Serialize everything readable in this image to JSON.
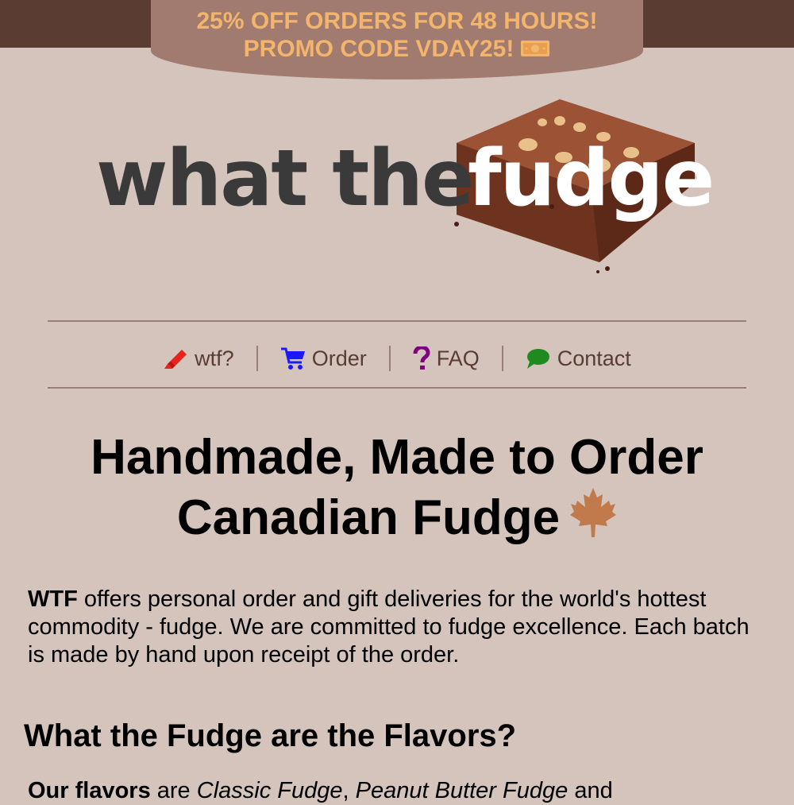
{
  "promo": {
    "line1": "25% OFF ORDERS FOR 48 HOURS!",
    "line2": "PROMO CODE VDAY25!",
    "icon": "money-icon"
  },
  "logo": {
    "text_left": "what the",
    "text_right": "fudge"
  },
  "nav": {
    "items": [
      {
        "label": "wtf?",
        "icon": "marker-icon",
        "color": "#e8231e"
      },
      {
        "label": "Order",
        "icon": "cart-icon",
        "color": "#1a1aff"
      },
      {
        "label": "FAQ",
        "icon": "question-icon",
        "color": "#800080"
      },
      {
        "label": "Contact",
        "icon": "speech-bubble-icon",
        "color": "#1f8a1f"
      }
    ]
  },
  "hero": {
    "title_line1": "Handmade, Made to Order",
    "title_line2": "Canadian Fudge",
    "icon": "maple-leaf-icon"
  },
  "intro": {
    "brand": "WTF",
    "text": " offers personal order and gift deliveries for the world's hottest commodity - fudge. We are committed to fudge excellence. Each batch is made by hand upon receipt of the order."
  },
  "flavors_section": {
    "heading": "What the Fudge are the Flavors?",
    "lead": "Our flavors",
    "connector": " are ",
    "flavor1": "Classic Fudge",
    "sep": ", ",
    "flavor2": "Peanut Butter Fudge",
    "tail": " and"
  },
  "colors": {
    "background": "#d4c4bc",
    "topbar": "#5a3c33",
    "promo_bg": "#a17a70",
    "promo_text": "#f2b56b"
  }
}
